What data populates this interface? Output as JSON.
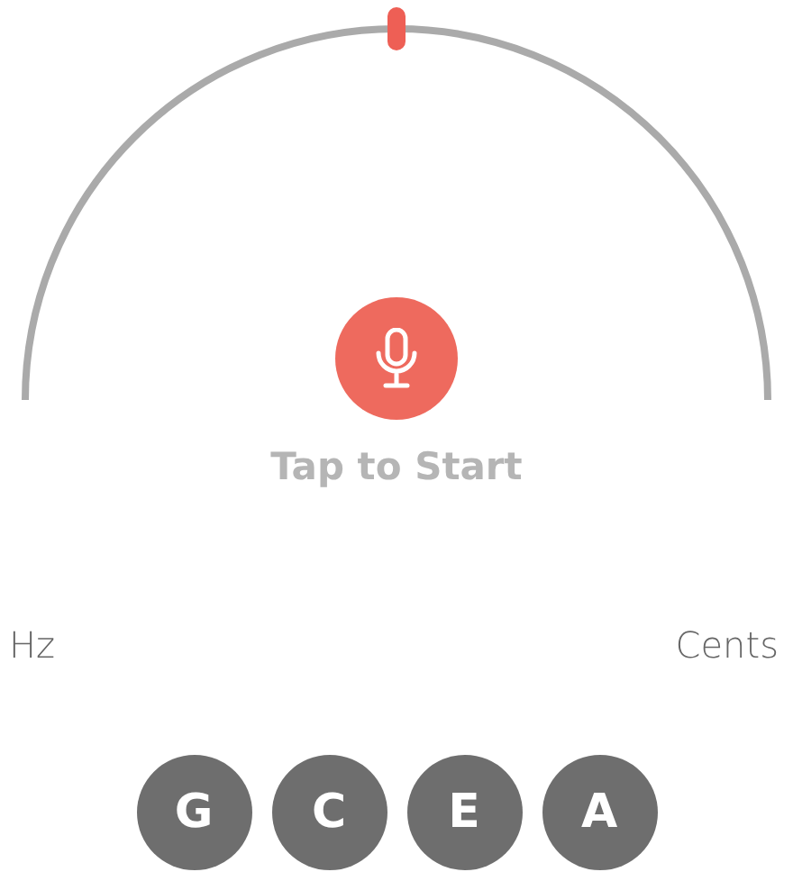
{
  "start": {
    "label": "Tap to Start"
  },
  "readouts": {
    "left": "Hz",
    "right": "Cents"
  },
  "strings": [
    {
      "label": "G"
    },
    {
      "label": "C"
    },
    {
      "label": "E"
    },
    {
      "label": "A"
    }
  ]
}
